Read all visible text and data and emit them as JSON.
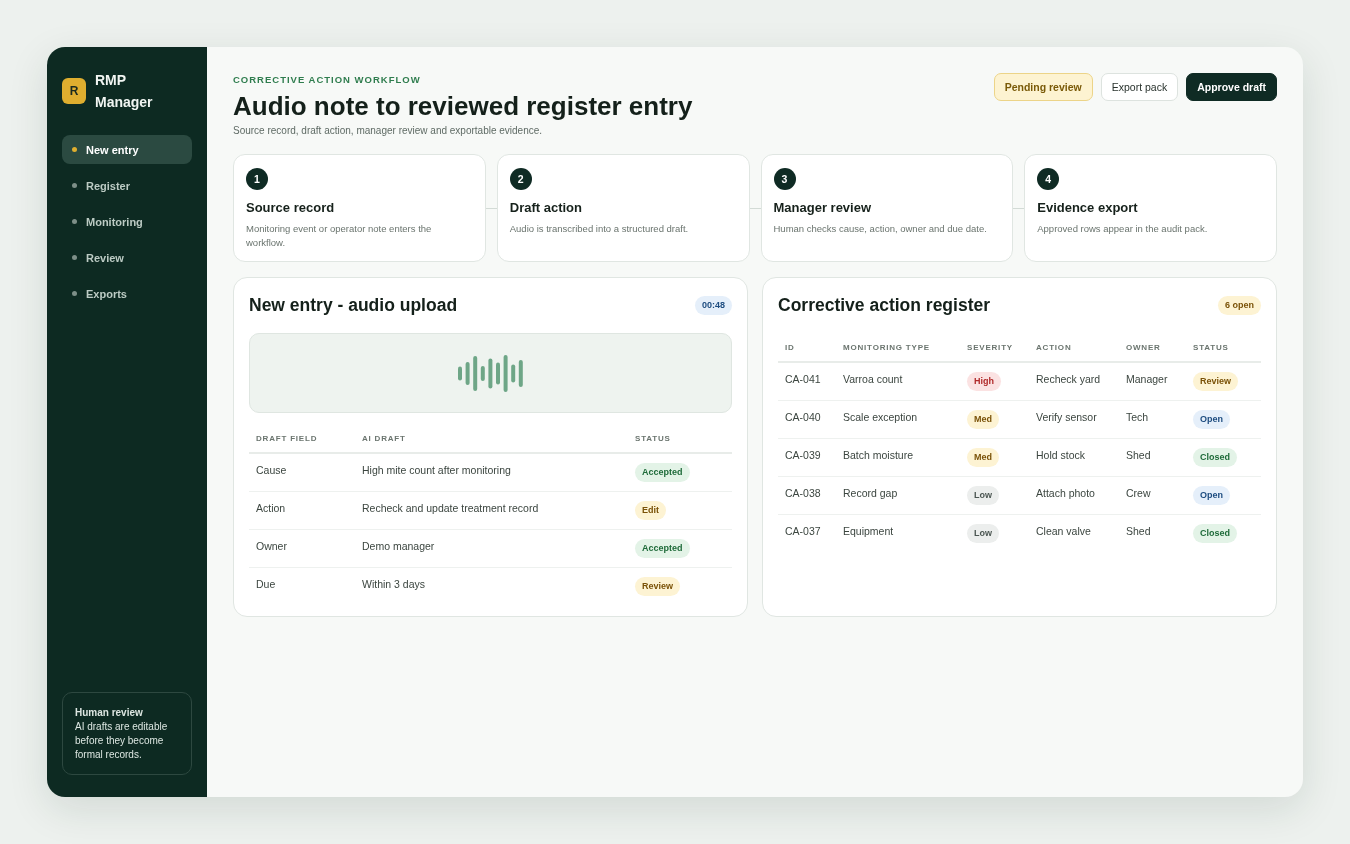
{
  "sidebar": {
    "logo_letter": "R",
    "app_name": "RMP Manager",
    "nav": [
      {
        "label": "New entry",
        "selected": true
      },
      {
        "label": "Register",
        "selected": false
      },
      {
        "label": "Monitoring",
        "selected": false
      },
      {
        "label": "Review",
        "selected": false
      },
      {
        "label": "Exports",
        "selected": false
      }
    ],
    "note": {
      "title": "Human review",
      "text": "AI drafts are editable before they become formal records."
    }
  },
  "header": {
    "eyebrow": "CORRECTIVE ACTION WORKFLOW",
    "title": "Audio note to reviewed register entry",
    "subtitle": "Source record, draft action, manager review and exportable evidence.",
    "actions": [
      {
        "label": "Pending review",
        "kind": "status"
      },
      {
        "label": "Export pack",
        "kind": "secondary"
      },
      {
        "label": "Approve draft",
        "kind": "primary"
      }
    ]
  },
  "steps": [
    {
      "number": "1",
      "title": "Source record",
      "description": "Monitoring event or operator note enters the workflow."
    },
    {
      "number": "2",
      "title": "Draft action",
      "description": "Audio is transcribed into a structured draft."
    },
    {
      "number": "3",
      "title": "Manager review",
      "description": "Human checks cause, action, owner and due date."
    },
    {
      "number": "4",
      "title": "Evidence export",
      "description": "Approved rows appear in the audit pack."
    }
  ],
  "audio_panel": {
    "title": "New entry - audio upload",
    "duration": {
      "label": "00:48",
      "kind": "info"
    },
    "table": {
      "columns": [
        "DRAFT FIELD",
        "AI DRAFT",
        "STATUS"
      ],
      "rows": [
        {
          "field": "Cause",
          "draft": "High mite count after monitoring",
          "status": {
            "label": "Accepted",
            "kind": "success"
          }
        },
        {
          "field": "Action",
          "draft": "Recheck and update treatment record",
          "status": {
            "label": "Edit",
            "kind": "warning"
          }
        },
        {
          "field": "Owner",
          "draft": "Demo manager",
          "status": {
            "label": "Accepted",
            "kind": "success"
          }
        },
        {
          "field": "Due",
          "draft": "Within 3 days",
          "status": {
            "label": "Review",
            "kind": "warning"
          }
        }
      ]
    }
  },
  "register_panel": {
    "title": "Corrective action register",
    "count": {
      "label": "6 open",
      "kind": "warning"
    },
    "table": {
      "columns": [
        "ID",
        "MONITORING TYPE",
        "SEVERITY",
        "ACTION",
        "OWNER",
        "STATUS"
      ],
      "rows": [
        {
          "id": "CA-041",
          "monitoring_type": "Varroa count",
          "severity": {
            "label": "High",
            "kind": "danger"
          },
          "action": "Recheck yard",
          "owner": "Manager",
          "status": {
            "label": "Review",
            "kind": "warning"
          }
        },
        {
          "id": "CA-040",
          "monitoring_type": "Scale exception",
          "severity": {
            "label": "Med",
            "kind": "warning"
          },
          "action": "Verify sensor",
          "owner": "Tech",
          "status": {
            "label": "Open",
            "kind": "info"
          }
        },
        {
          "id": "CA-039",
          "monitoring_type": "Batch moisture",
          "severity": {
            "label": "Med",
            "kind": "warning"
          },
          "action": "Hold stock",
          "owner": "Shed",
          "status": {
            "label": "Closed",
            "kind": "success"
          }
        },
        {
          "id": "CA-038",
          "monitoring_type": "Record gap",
          "severity": {
            "label": "Low",
            "kind": "neutral"
          },
          "action": "Attach photo",
          "owner": "Crew",
          "status": {
            "label": "Open",
            "kind": "info"
          }
        },
        {
          "id": "CA-037",
          "monitoring_type": "Equipment",
          "severity": {
            "label": "Low",
            "kind": "neutral"
          },
          "action": "Clean valve",
          "owner": "Shed",
          "status": {
            "label": "Closed",
            "kind": "success"
          }
        }
      ]
    }
  }
}
